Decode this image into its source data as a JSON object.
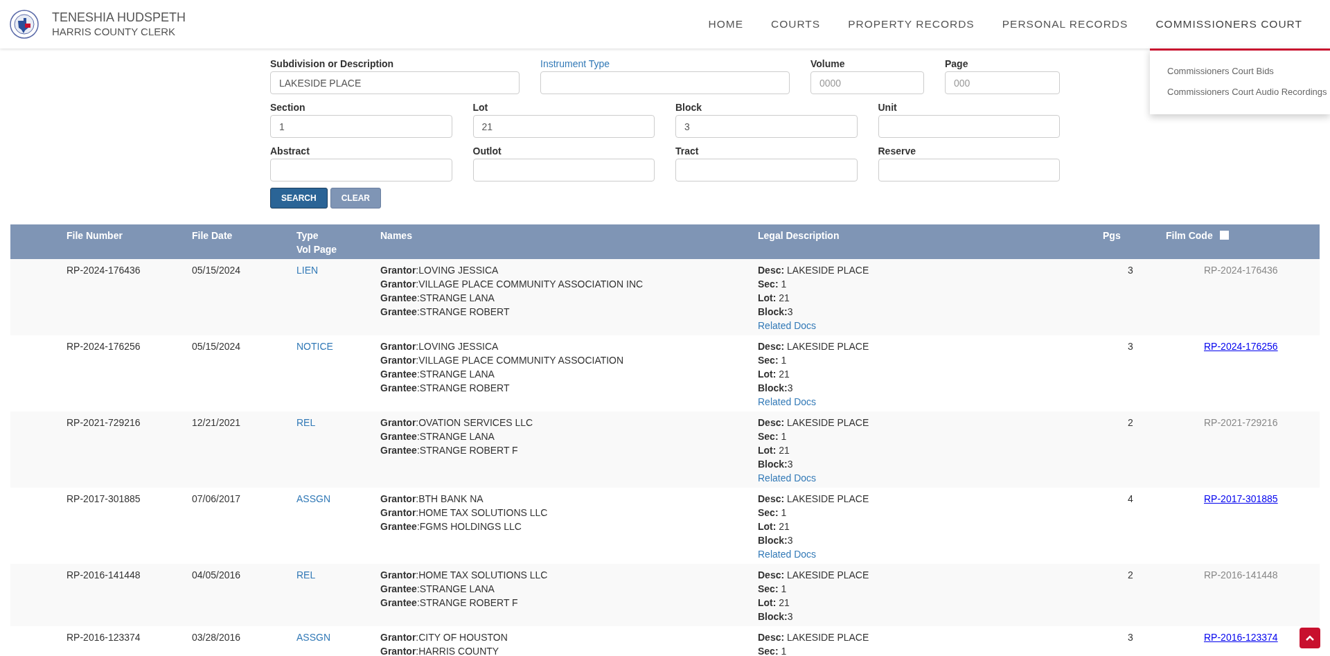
{
  "header": {
    "title": "TENESHIA HUDSPETH",
    "subtitle": "HARRIS COUNTY CLERK"
  },
  "nav": [
    {
      "label": "HOME",
      "selected": false
    },
    {
      "label": "COURTS",
      "selected": false
    },
    {
      "label": "PROPERTY RECORDS",
      "selected": false
    },
    {
      "label": "PERSONAL RECORDS",
      "selected": false
    },
    {
      "label": "COMMISSIONERS COURT",
      "selected": true
    }
  ],
  "dropdown": [
    "Commissioners Court Bids",
    "Commissioners Court Audio Recordings"
  ],
  "form_rows": [
    [
      {
        "label": "Subdivision or Description",
        "value": "LAKESIDE PLACE",
        "kind": "bold"
      },
      {
        "label": "Instrument Type",
        "kind": "link"
      },
      {
        "label": "Volume",
        "placeholder": "0000",
        "kind": "bold"
      },
      {
        "label": "Page",
        "placeholder": "000",
        "kind": "bold"
      }
    ],
    [
      {
        "label": "Section",
        "value": "1",
        "kind": "bold"
      },
      {
        "label": "Lot",
        "value": "21",
        "kind": "bold"
      },
      {
        "label": "Block",
        "value": "3",
        "kind": "bold"
      },
      {
        "label": "Unit",
        "kind": "bold"
      }
    ],
    [
      {
        "label": "Abstract",
        "kind": "bold"
      },
      {
        "label": "Outlot",
        "kind": "bold"
      },
      {
        "label": "Tract",
        "kind": "bold"
      },
      {
        "label": "Reserve",
        "kind": "bold"
      }
    ]
  ],
  "buttons": [
    {
      "label": "SEARCH",
      "kind": "primary"
    },
    {
      "label": "CLEAR",
      "kind": "secondary"
    }
  ],
  "table": {
    "columns": [
      "File Number",
      "File Date",
      "Type\nVol Page",
      "Names",
      "Legal Description",
      "Pgs",
      "Film Code"
    ],
    "film_code_checked": false,
    "rows": [
      {
        "file_number": "RP-2024-176436",
        "file_date": "05/15/2024",
        "type": "LIEN",
        "names": [
          "**Grantor**:LOVING JESSICA",
          "**Grantor**:VILLAGE PLACE COMMUNITY ASSOCIATION INC",
          "**Grantee**:STRANGE LANA",
          "**Grantee**:STRANGE ROBERT"
        ],
        "legal": [
          "**Desc:** LAKESIDE PLACE",
          "**Sec:** 1",
          "**Lot:** 21",
          "**Block:**3"
        ],
        "related_docs": "Related Docs",
        "pages": "3",
        "film_code": {
          "text": "RP-2024-176436",
          "linked": false
        }
      },
      {
        "file_number": "RP-2024-176256",
        "file_date": "05/15/2024",
        "type": "NOTICE",
        "names": [
          "**Grantor**:LOVING JESSICA",
          "**Grantor**:VILLAGE PLACE COMMUNITY ASSOCIATION",
          "**Grantee**:STRANGE LANA",
          "**Grantee**:STRANGE ROBERT"
        ],
        "legal": [
          "**Desc:** LAKESIDE PLACE",
          "**Sec:** 1",
          "**Lot:** 21",
          "**Block:**3"
        ],
        "related_docs": "Related Docs",
        "pages": "3",
        "film_code": {
          "text": "RP-2024-176256",
          "linked": true
        }
      },
      {
        "file_number": "RP-2021-729216",
        "file_date": "12/21/2021",
        "type": "REL",
        "names": [
          "**Grantor**:OVATION SERVICES LLC",
          "**Grantee**:STRANGE LANA",
          "**Grantee**:STRANGE ROBERT F"
        ],
        "legal": [
          "**Desc:** LAKESIDE PLACE",
          "**Sec:** 1",
          "**Lot:** 21",
          "**Block:**3"
        ],
        "related_docs": "Related Docs",
        "pages": "2",
        "film_code": {
          "text": "RP-2021-729216",
          "linked": false
        }
      },
      {
        "file_number": "RP-2017-301885",
        "file_date": "07/06/2017",
        "type": "ASSGN",
        "names": [
          "**Grantor**:BTH BANK NA",
          "**Grantor**:HOME TAX SOLUTIONS LLC",
          "**Grantee**:FGMS HOLDINGS LLC"
        ],
        "legal": [
          "**Desc:** LAKESIDE PLACE",
          "**Sec:** 1",
          "**Lot:** 21",
          "**Block:**3"
        ],
        "related_docs": "Related Docs",
        "pages": "4",
        "film_code": {
          "text": "RP-2017-301885",
          "linked": true
        }
      },
      {
        "file_number": "RP-2016-141448",
        "file_date": "04/05/2016",
        "type": "REL",
        "names": [
          "**Grantor**:HOME TAX SOLUTIONS LLC",
          "**Grantee**:STRANGE LANA",
          "**Grantee**:STRANGE ROBERT F"
        ],
        "legal": [
          "**Desc:** LAKESIDE PLACE",
          "**Sec:** 1",
          "**Lot:** 21",
          "**Block:**3"
        ],
        "pages": "2",
        "film_code": {
          "text": "RP-2016-141448",
          "linked": false
        }
      },
      {
        "file_number": "RP-2016-123374",
        "file_date": "03/28/2016",
        "type": "ASSGN",
        "names": [
          "**Grantor**:CITY OF HOUSTON",
          "**Grantor**:HARRIS COUNTY"
        ],
        "legal": [
          "**Desc:** LAKESIDE PLACE",
          "**Sec:** 1"
        ],
        "pages": "3",
        "film_code": {
          "text": "RP-2016-123374",
          "linked": true
        }
      }
    ]
  }
}
